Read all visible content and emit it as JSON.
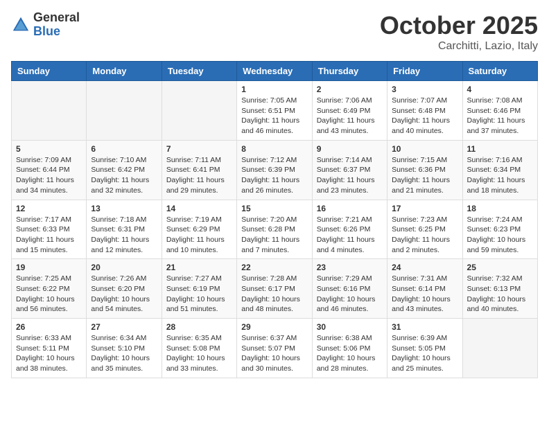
{
  "logo": {
    "general": "General",
    "blue": "Blue"
  },
  "title": "October 2025",
  "location": "Carchitti, Lazio, Italy",
  "days_of_week": [
    "Sunday",
    "Monday",
    "Tuesday",
    "Wednesday",
    "Thursday",
    "Friday",
    "Saturday"
  ],
  "weeks": [
    [
      {
        "day": "",
        "info": ""
      },
      {
        "day": "",
        "info": ""
      },
      {
        "day": "",
        "info": ""
      },
      {
        "day": "1",
        "info": "Sunrise: 7:05 AM\nSunset: 6:51 PM\nDaylight: 11 hours\nand 46 minutes."
      },
      {
        "day": "2",
        "info": "Sunrise: 7:06 AM\nSunset: 6:49 PM\nDaylight: 11 hours\nand 43 minutes."
      },
      {
        "day": "3",
        "info": "Sunrise: 7:07 AM\nSunset: 6:48 PM\nDaylight: 11 hours\nand 40 minutes."
      },
      {
        "day": "4",
        "info": "Sunrise: 7:08 AM\nSunset: 6:46 PM\nDaylight: 11 hours\nand 37 minutes."
      }
    ],
    [
      {
        "day": "5",
        "info": "Sunrise: 7:09 AM\nSunset: 6:44 PM\nDaylight: 11 hours\nand 34 minutes."
      },
      {
        "day": "6",
        "info": "Sunrise: 7:10 AM\nSunset: 6:42 PM\nDaylight: 11 hours\nand 32 minutes."
      },
      {
        "day": "7",
        "info": "Sunrise: 7:11 AM\nSunset: 6:41 PM\nDaylight: 11 hours\nand 29 minutes."
      },
      {
        "day": "8",
        "info": "Sunrise: 7:12 AM\nSunset: 6:39 PM\nDaylight: 11 hours\nand 26 minutes."
      },
      {
        "day": "9",
        "info": "Sunrise: 7:14 AM\nSunset: 6:37 PM\nDaylight: 11 hours\nand 23 minutes."
      },
      {
        "day": "10",
        "info": "Sunrise: 7:15 AM\nSunset: 6:36 PM\nDaylight: 11 hours\nand 21 minutes."
      },
      {
        "day": "11",
        "info": "Sunrise: 7:16 AM\nSunset: 6:34 PM\nDaylight: 11 hours\nand 18 minutes."
      }
    ],
    [
      {
        "day": "12",
        "info": "Sunrise: 7:17 AM\nSunset: 6:33 PM\nDaylight: 11 hours\nand 15 minutes."
      },
      {
        "day": "13",
        "info": "Sunrise: 7:18 AM\nSunset: 6:31 PM\nDaylight: 11 hours\nand 12 minutes."
      },
      {
        "day": "14",
        "info": "Sunrise: 7:19 AM\nSunset: 6:29 PM\nDaylight: 11 hours\nand 10 minutes."
      },
      {
        "day": "15",
        "info": "Sunrise: 7:20 AM\nSunset: 6:28 PM\nDaylight: 11 hours\nand 7 minutes."
      },
      {
        "day": "16",
        "info": "Sunrise: 7:21 AM\nSunset: 6:26 PM\nDaylight: 11 hours\nand 4 minutes."
      },
      {
        "day": "17",
        "info": "Sunrise: 7:23 AM\nSunset: 6:25 PM\nDaylight: 11 hours\nand 2 minutes."
      },
      {
        "day": "18",
        "info": "Sunrise: 7:24 AM\nSunset: 6:23 PM\nDaylight: 10 hours\nand 59 minutes."
      }
    ],
    [
      {
        "day": "19",
        "info": "Sunrise: 7:25 AM\nSunset: 6:22 PM\nDaylight: 10 hours\nand 56 minutes."
      },
      {
        "day": "20",
        "info": "Sunrise: 7:26 AM\nSunset: 6:20 PM\nDaylight: 10 hours\nand 54 minutes."
      },
      {
        "day": "21",
        "info": "Sunrise: 7:27 AM\nSunset: 6:19 PM\nDaylight: 10 hours\nand 51 minutes."
      },
      {
        "day": "22",
        "info": "Sunrise: 7:28 AM\nSunset: 6:17 PM\nDaylight: 10 hours\nand 48 minutes."
      },
      {
        "day": "23",
        "info": "Sunrise: 7:29 AM\nSunset: 6:16 PM\nDaylight: 10 hours\nand 46 minutes."
      },
      {
        "day": "24",
        "info": "Sunrise: 7:31 AM\nSunset: 6:14 PM\nDaylight: 10 hours\nand 43 minutes."
      },
      {
        "day": "25",
        "info": "Sunrise: 7:32 AM\nSunset: 6:13 PM\nDaylight: 10 hours\nand 40 minutes."
      }
    ],
    [
      {
        "day": "26",
        "info": "Sunrise: 6:33 AM\nSunset: 5:11 PM\nDaylight: 10 hours\nand 38 minutes."
      },
      {
        "day": "27",
        "info": "Sunrise: 6:34 AM\nSunset: 5:10 PM\nDaylight: 10 hours\nand 35 minutes."
      },
      {
        "day": "28",
        "info": "Sunrise: 6:35 AM\nSunset: 5:08 PM\nDaylight: 10 hours\nand 33 minutes."
      },
      {
        "day": "29",
        "info": "Sunrise: 6:37 AM\nSunset: 5:07 PM\nDaylight: 10 hours\nand 30 minutes."
      },
      {
        "day": "30",
        "info": "Sunrise: 6:38 AM\nSunset: 5:06 PM\nDaylight: 10 hours\nand 28 minutes."
      },
      {
        "day": "31",
        "info": "Sunrise: 6:39 AM\nSunset: 5:05 PM\nDaylight: 10 hours\nand 25 minutes."
      },
      {
        "day": "",
        "info": ""
      }
    ]
  ]
}
